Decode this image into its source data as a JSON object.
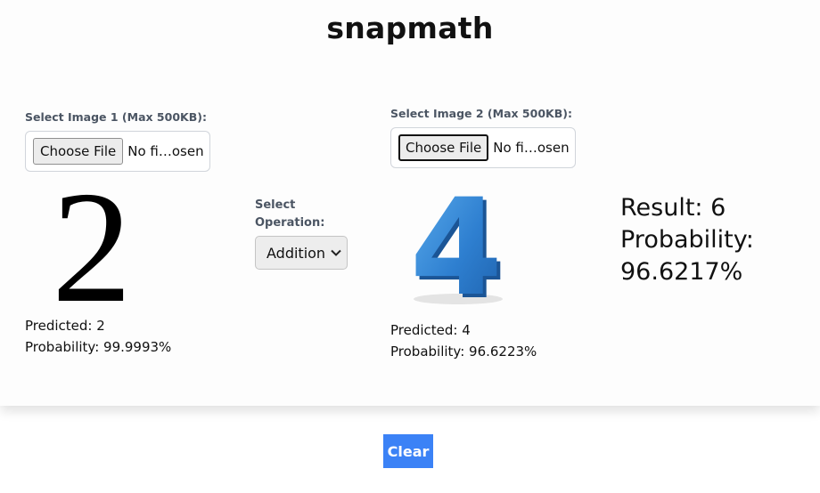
{
  "app": {
    "title": "snapmath"
  },
  "image1": {
    "label": "Select Image 1 (Max 500KB):",
    "button": "Choose File",
    "file_text": "No fi…osen",
    "digit": "2",
    "predicted": "Predicted: 2",
    "probability": "Probability: 99.9993%"
  },
  "image2": {
    "label": "Select Image 2 (Max 500KB):",
    "button": "Choose File",
    "file_text": "No fi…osen",
    "digit": "4",
    "predicted": "Predicted: 4",
    "probability": "Probability: 96.6223%"
  },
  "operation": {
    "label_line1": "Select",
    "label_line2": "Operation:",
    "selected": "Addition"
  },
  "result": {
    "line1": "Result: 6",
    "line2": "Probability:",
    "line3": "96.6217%"
  },
  "actions": {
    "clear": "Clear"
  },
  "colors": {
    "accent": "#3b82f6",
    "digit4_blue": "#2e7fd0"
  },
  "icons": {
    "select_arrow": "chevron-down-icon"
  }
}
